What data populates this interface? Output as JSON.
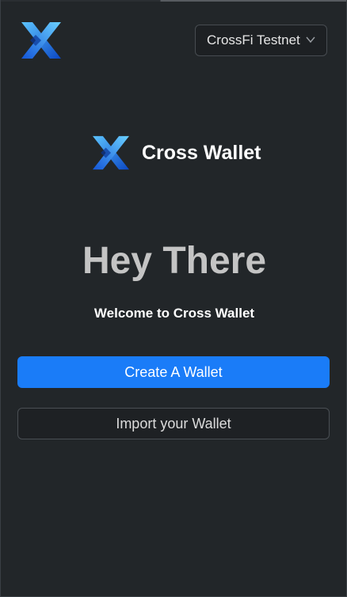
{
  "header": {
    "logo_icon": "crossfi-x-logo-icon",
    "network_select": {
      "selected": "CrossFi Testnet",
      "icon": "chevron-down-icon"
    }
  },
  "brand": {
    "logo_icon": "crossfi-x-logo-icon",
    "name": "Cross Wallet"
  },
  "hero": {
    "title": "Hey There",
    "subtitle": "Welcome to Cross Wallet"
  },
  "actions": {
    "create_label": "Create A Wallet",
    "import_label": "Import your Wallet"
  },
  "colors": {
    "background": "#222629",
    "primary": "#1a7cf8",
    "logo_light": "#4fb6ff",
    "logo_dark": "#0a3fb0"
  }
}
